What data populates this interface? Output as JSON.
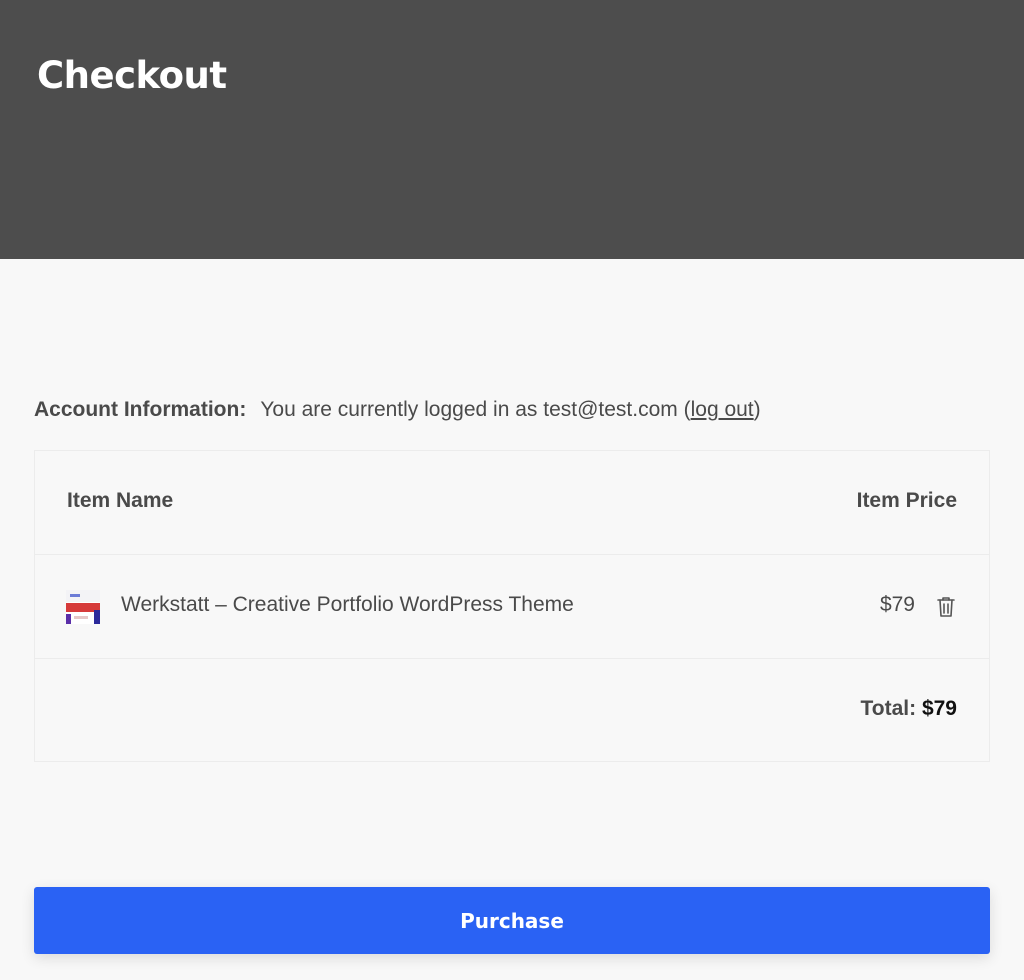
{
  "header": {
    "title": "Checkout",
    "background_color": "#4d4d4d"
  },
  "account": {
    "label": "Account Information:",
    "message": "You are currently logged in as test@test.com (",
    "logout_label": "log out",
    "message_end": ")"
  },
  "cart": {
    "columns": {
      "name": "Item Name",
      "price": "Item Price"
    },
    "items": [
      {
        "name": "Werkstatt – Creative Portfolio WordPress Theme",
        "price": "$79",
        "thumbnail_icon": "theme-thumbnail",
        "remove_icon": "trash-icon"
      }
    ],
    "total_label": "Total:",
    "total_value": "$79"
  },
  "purchase": {
    "label": "Purchase",
    "color": "#2a62f4"
  }
}
